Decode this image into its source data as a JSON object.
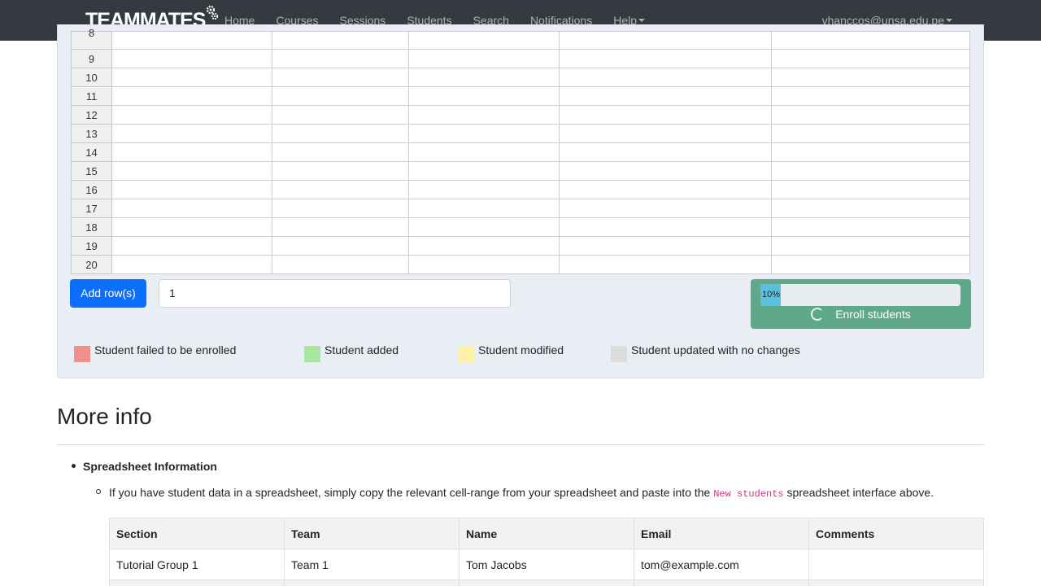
{
  "navbar": {
    "brand": "TEAMMATES",
    "links": [
      "Home",
      "Courses",
      "Sessions",
      "Students",
      "Search",
      "Notifications",
      "Help"
    ],
    "user": "vhanccos@unsa.edu.pe"
  },
  "sheet": {
    "row_numbers": [
      "8",
      "9",
      "10",
      "11",
      "12",
      "13",
      "14",
      "15",
      "16",
      "17",
      "18",
      "19",
      "20"
    ]
  },
  "controls": {
    "add_rows_label": "Add row(s)",
    "rows_count": "1",
    "progress_text": "10%",
    "progress_value": 10,
    "enroll_label": "Enroll students"
  },
  "legend": [
    {
      "label": "Student failed to be enrolled",
      "color": "#f0908a"
    },
    {
      "label": "Student added",
      "color": "#a9e6a1"
    },
    {
      "label": "Student modified",
      "color": "#fff3a8"
    },
    {
      "label": "Student updated with no changes",
      "color": "#dcdcdc"
    }
  ],
  "more_info": {
    "title": "More info",
    "bullet_title": "Spreadsheet Information",
    "line_before": "If you have student data in a spreadsheet, simply copy the relevant cell-range from your spreadsheet and paste into the ",
    "line_code": "New students",
    "line_after": " spreadsheet interface above.",
    "table_headers": [
      "Section",
      "Team",
      "Name",
      "Email",
      "Comments"
    ],
    "table_rows": [
      [
        "Tutorial Group 1",
        "Team 1",
        "Tom Jacobs",
        "tom@example.com",
        ""
      ]
    ]
  }
}
